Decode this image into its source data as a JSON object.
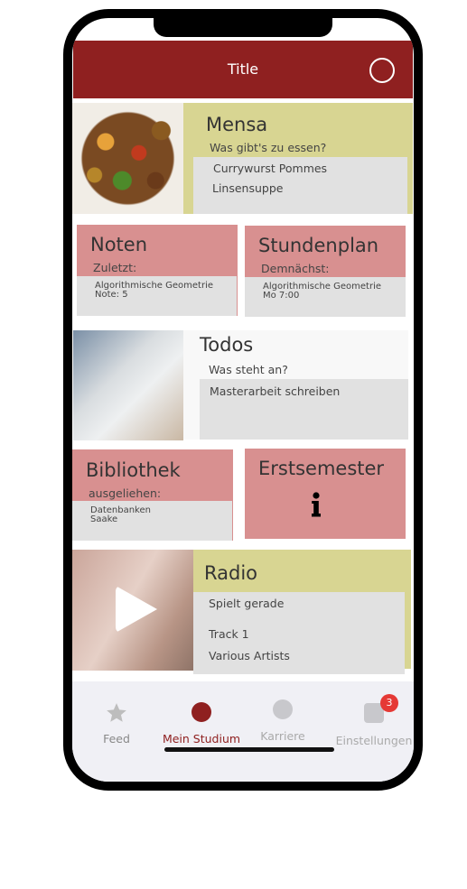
{
  "header": {
    "title": "Title"
  },
  "mensa": {
    "title": "Mensa",
    "subtitle": "Was gibt's zu essen?",
    "items": [
      "Currywurst Pommes",
      "Linsensuppe"
    ]
  },
  "noten": {
    "title": "Noten",
    "subtitle": "Zuletzt:",
    "line1": "Algorithmische Geometrie",
    "line2": "Note: 5"
  },
  "stundenplan": {
    "title": "Stundenplan",
    "subtitle": "Demnächst:",
    "line1": "Algorithmische Geometrie",
    "line2": "Mo 7:00"
  },
  "todos": {
    "title": "Todos",
    "subtitle": "Was steht an?",
    "items": [
      "Masterarbeit schreiben"
    ]
  },
  "bibliothek": {
    "title": "Bibliothek",
    "subtitle": "ausgeliehen:",
    "line1": "Datenbanken",
    "line2": "Saake"
  },
  "erstsemester": {
    "title": "Erstsemester",
    "icon": "info-icon"
  },
  "radio": {
    "title": "Radio",
    "subtitle": "Spielt gerade",
    "track": "Track 1",
    "artist": "Various Artists"
  },
  "tabs": [
    {
      "label": "Feed",
      "icon": "star-icon",
      "color": "#bdbdbd"
    },
    {
      "label": "Mein Studium",
      "icon": "circle-icon",
      "color": "#8f2020"
    },
    {
      "label": "Karriere",
      "icon": "circle-icon",
      "color": "#c8c8cc"
    },
    {
      "label": "Einstellungen",
      "icon": "square-icon",
      "color": "#c8c8cc",
      "badge": "3"
    }
  ],
  "colors": {
    "accent": "#8f2020",
    "olive": "#d8d592",
    "rose": "#d89090",
    "grey": "#e1e1e1"
  }
}
